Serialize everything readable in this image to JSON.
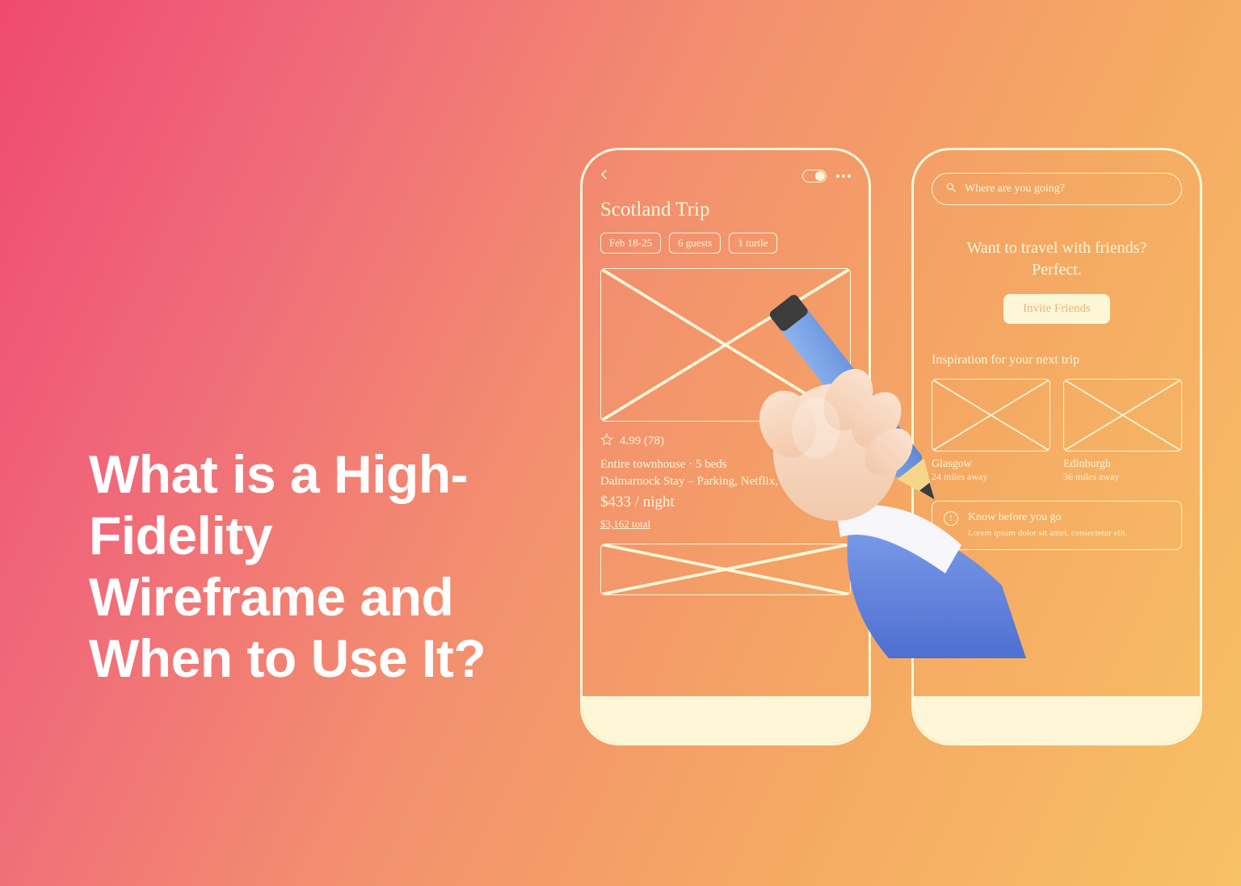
{
  "title": "What is a High-Fidelity Wireframe and When to Use It?",
  "phone1": {
    "trip_title": "Scotland Trip",
    "chips": [
      "Feb 18-25",
      "6 guests",
      "1 turtle"
    ],
    "rating": "4.99 (78)",
    "desc1": "Entire townhouse · 5 beds",
    "desc2": "Dalmarnock Stay – Parking, Netflix, and ...",
    "price": "$433 / night",
    "total": "$3,162 total"
  },
  "phone2": {
    "search_placeholder": "Where are you going?",
    "promo_line1": "Want to travel with friends?",
    "promo_line2": "Perfect.",
    "invite_button": "Invite Friends",
    "inspiration_heading": "Inspiration for your next trip",
    "cards": [
      {
        "name": "Glasgow",
        "sub": "24 miles away"
      },
      {
        "name": "Edinburgh",
        "sub": "36 miles away"
      }
    ],
    "know_title": "Know before you go",
    "know_body": "Lorem ipsum dolor sit amet, consectetur elit."
  }
}
